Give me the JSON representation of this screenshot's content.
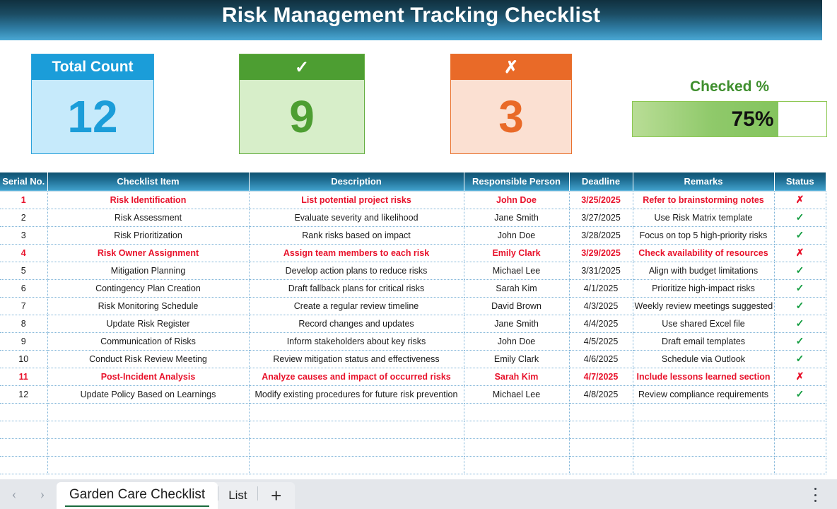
{
  "banner": {
    "title": "Risk Management Tracking Checklist"
  },
  "kpis": {
    "total": {
      "label": "Total Count",
      "value": "12"
    },
    "checked": {
      "label": "✓",
      "value": "9"
    },
    "unchecked": {
      "label": "✗",
      "value": "3"
    }
  },
  "gauge": {
    "label": "Checked %",
    "value": "75%",
    "percent": 75
  },
  "table": {
    "columns": [
      "Serial No.",
      "Checklist Item",
      "Description",
      "Responsible Person",
      "Deadline",
      "Remarks",
      "Status"
    ],
    "rows": [
      {
        "serial": "1",
        "item": "Risk Identification",
        "description": "List potential project risks",
        "person": "John Doe",
        "deadline": "3/25/2025",
        "remarks": "Refer to brainstorming notes",
        "status": "✗",
        "flagged": true
      },
      {
        "serial": "2",
        "item": "Risk Assessment",
        "description": "Evaluate severity and likelihood",
        "person": "Jane Smith",
        "deadline": "3/27/2025",
        "remarks": "Use Risk Matrix template",
        "status": "✓",
        "flagged": false
      },
      {
        "serial": "3",
        "item": "Risk Prioritization",
        "description": "Rank risks based on impact",
        "person": "John Doe",
        "deadline": "3/28/2025",
        "remarks": "Focus on top 5 high-priority risks",
        "status": "✓",
        "flagged": false
      },
      {
        "serial": "4",
        "item": "Risk Owner Assignment",
        "description": "Assign team members to each risk",
        "person": "Emily Clark",
        "deadline": "3/29/2025",
        "remarks": "Check availability of resources",
        "status": "✗",
        "flagged": true
      },
      {
        "serial": "5",
        "item": "Mitigation Planning",
        "description": "Develop action plans to reduce risks",
        "person": "Michael Lee",
        "deadline": "3/31/2025",
        "remarks": "Align with budget limitations",
        "status": "✓",
        "flagged": false
      },
      {
        "serial": "6",
        "item": "Contingency Plan Creation",
        "description": "Draft fallback plans for critical risks",
        "person": "Sarah Kim",
        "deadline": "4/1/2025",
        "remarks": "Prioritize high-impact risks",
        "status": "✓",
        "flagged": false
      },
      {
        "serial": "7",
        "item": "Risk Monitoring Schedule",
        "description": "Create a regular review timeline",
        "person": "David Brown",
        "deadline": "4/3/2025",
        "remarks": "Weekly review meetings suggested",
        "status": "✓",
        "flagged": false
      },
      {
        "serial": "8",
        "item": "Update Risk Register",
        "description": "Record changes and updates",
        "person": "Jane Smith",
        "deadline": "4/4/2025",
        "remarks": "Use shared Excel file",
        "status": "✓",
        "flagged": false
      },
      {
        "serial": "9",
        "item": "Communication of Risks",
        "description": "Inform stakeholders about key risks",
        "person": "John Doe",
        "deadline": "4/5/2025",
        "remarks": "Draft email templates",
        "status": "✓",
        "flagged": false
      },
      {
        "serial": "10",
        "item": "Conduct Risk Review Meeting",
        "description": "Review mitigation status and effectiveness",
        "person": "Emily Clark",
        "deadline": "4/6/2025",
        "remarks": "Schedule via Outlook",
        "status": "✓",
        "flagged": false
      },
      {
        "serial": "11",
        "item": "Post-Incident Analysis",
        "description": "Analyze causes and impact of occurred risks",
        "person": "Sarah Kim",
        "deadline": "4/7/2025",
        "remarks": "Include lessons learned section",
        "status": "✗",
        "flagged": true
      },
      {
        "serial": "12",
        "item": "Update Policy Based on Learnings",
        "description": "Modify existing procedures for future risk prevention",
        "person": "Michael Lee",
        "deadline": "4/8/2025",
        "remarks": "Review compliance requirements",
        "status": "✓",
        "flagged": false
      }
    ],
    "empty_row_count": 4
  },
  "tabbar": {
    "prev_icon": "‹",
    "next_icon": "›",
    "tabs": [
      {
        "label": "Garden Care Checklist",
        "active": true
      },
      {
        "label": "List",
        "active": false
      }
    ],
    "add_label": "+",
    "menu_icon": "kebab-menu-icon"
  }
}
